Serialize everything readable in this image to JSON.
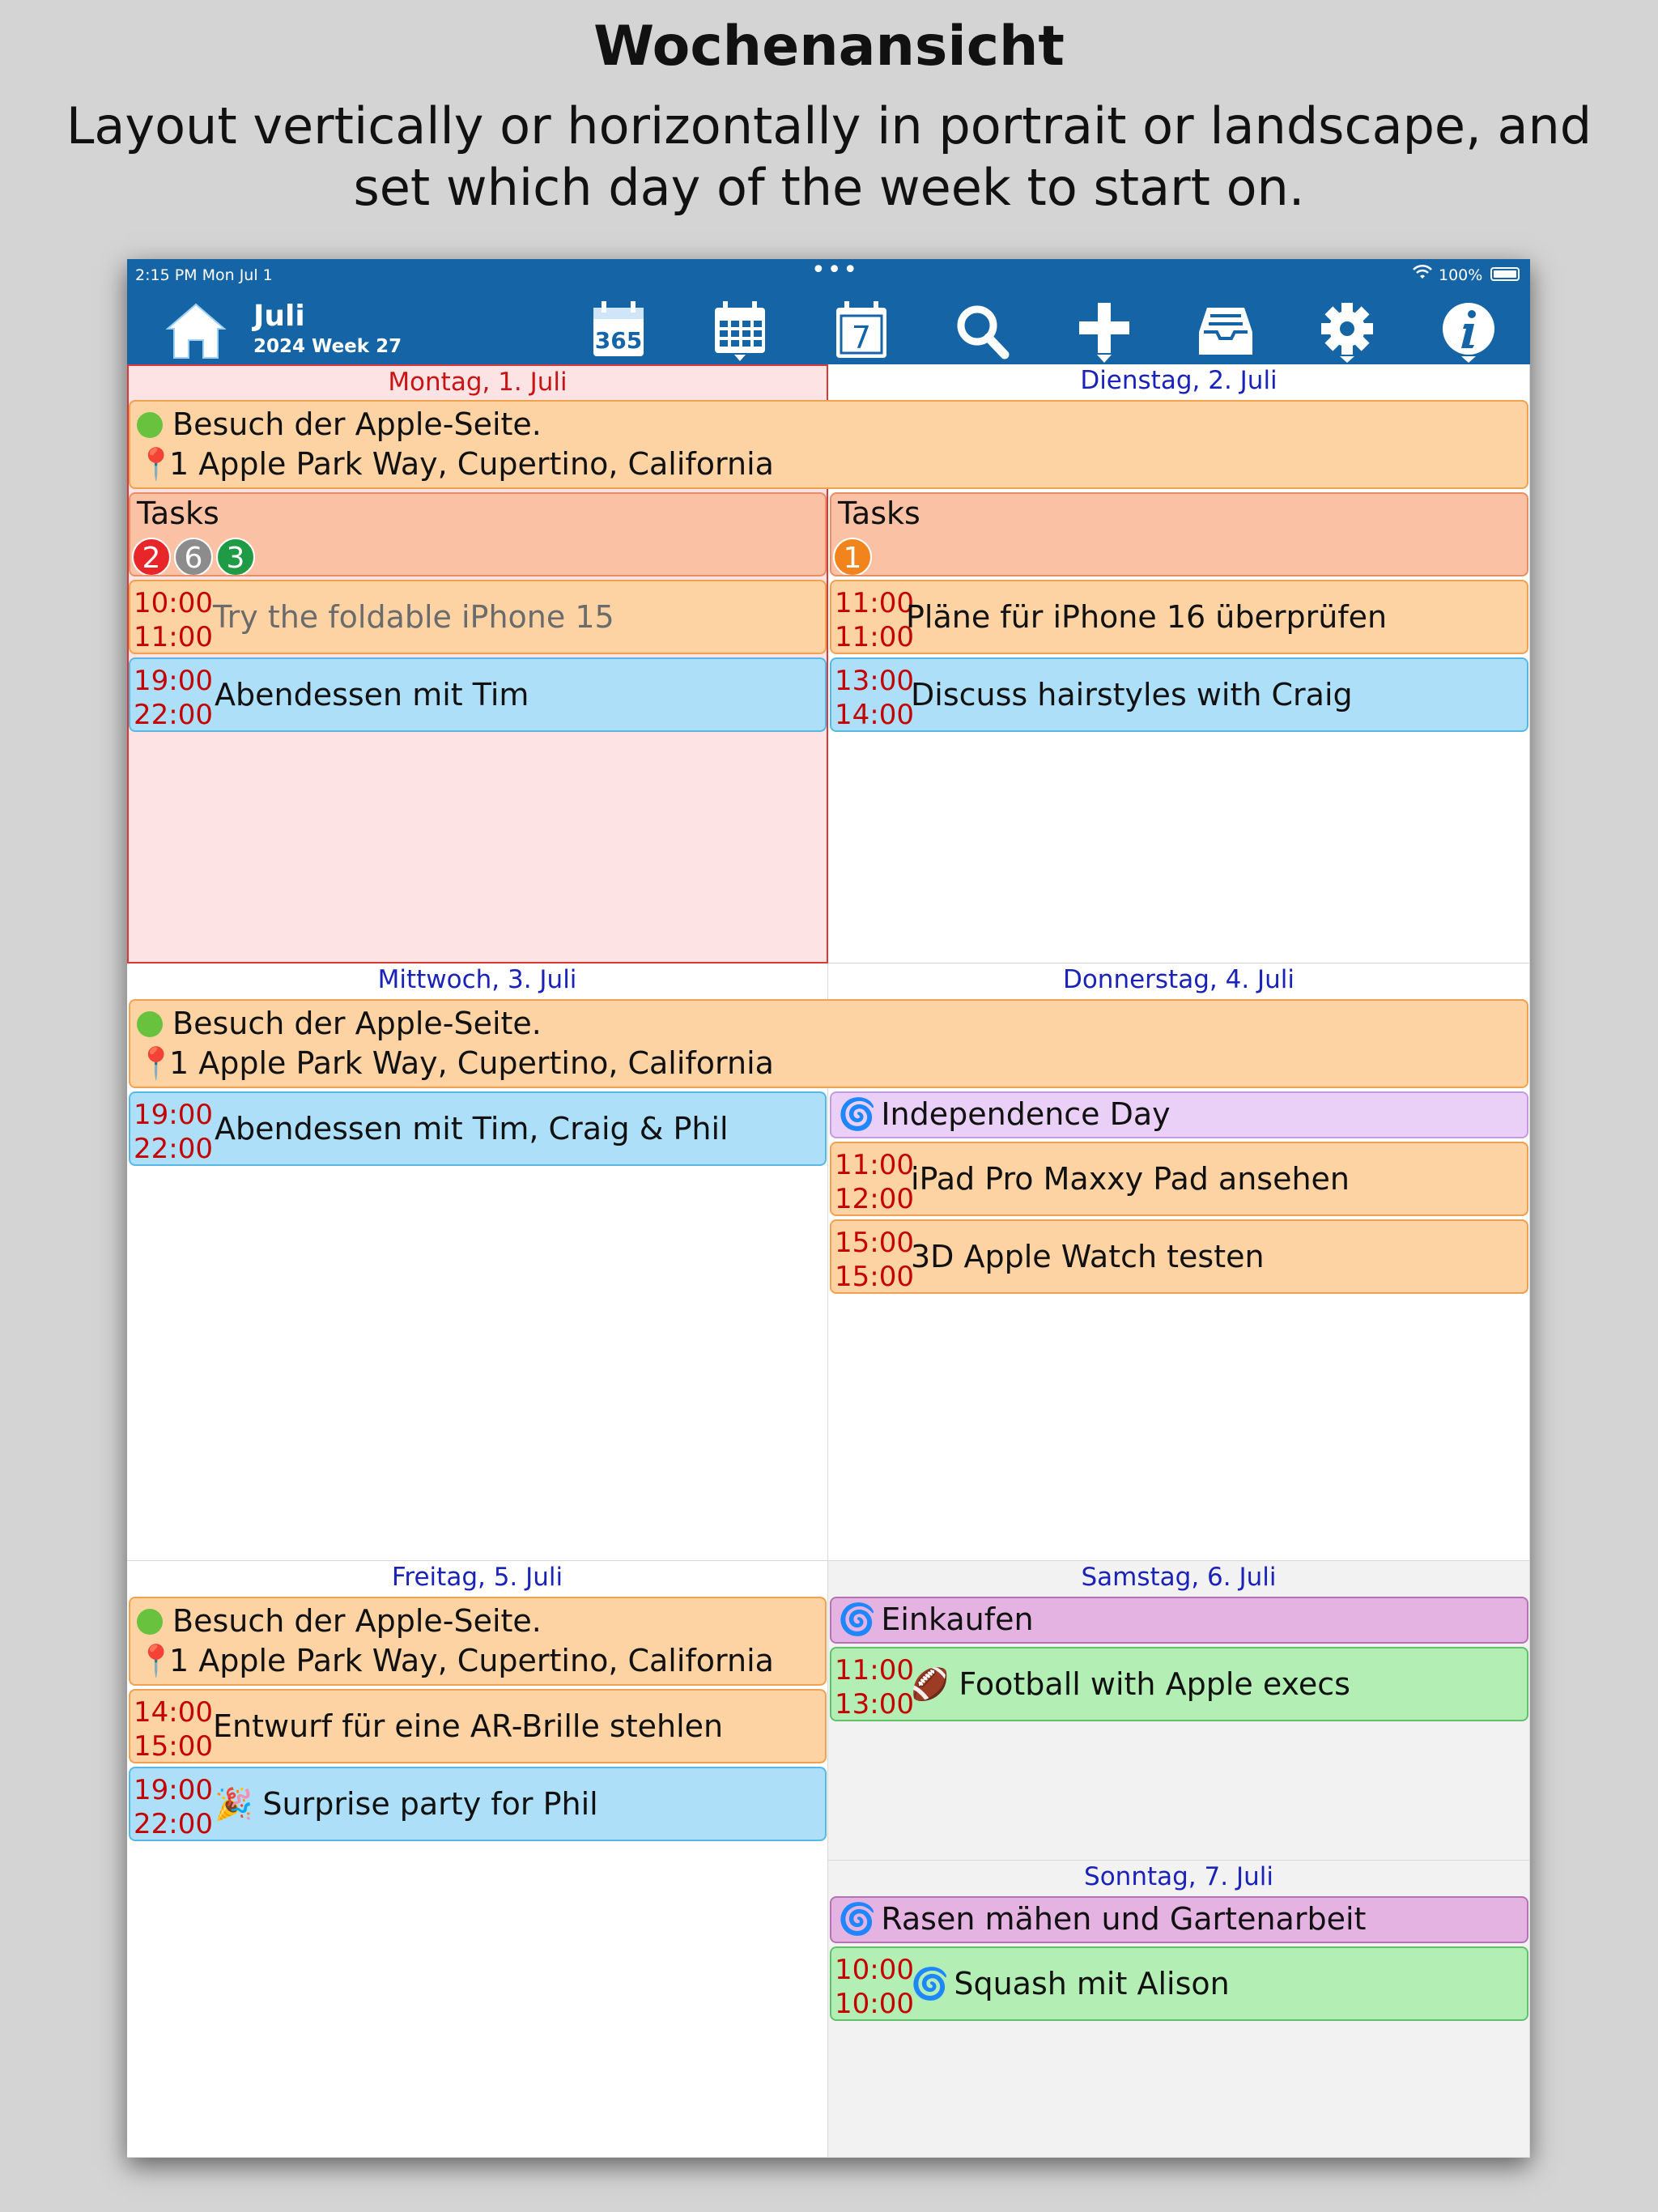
{
  "marketing": {
    "title": "Wochenansicht",
    "subtitle": "Layout vertically or horizontally in portrait or landscape, and set which day of the week to start on."
  },
  "statusbar": {
    "time": "2:15 PM   Mon Jul 1",
    "dots": "•••",
    "battery_text": "100%"
  },
  "toolbar": {
    "month": "Juli",
    "week": "2024 Week 27",
    "year_icon_text": "365",
    "day_icon_text": "7",
    "icons": [
      "home-icon",
      "year-view-icon",
      "month-view-icon",
      "day-view-icon",
      "search-icon",
      "add-icon",
      "inbox-icon",
      "settings-icon",
      "info-icon"
    ]
  },
  "colors": {
    "toolbar_bg": "#1565a6",
    "today_bg": "#fde3e4",
    "today_border": "#d83a3a",
    "time_red": "#c40000",
    "day_header_blue": "#1a23b8"
  },
  "days": {
    "mon": {
      "header": "Montag, 1. Juli",
      "tasks_label": "Tasks",
      "badges": [
        "2",
        "6",
        "3"
      ],
      "events": [
        {
          "start": "10:00",
          "end": "11:00",
          "title": "Try the foldable iPhone 15"
        },
        {
          "start": "19:00",
          "end": "22:00",
          "title": "Abendessen mit Tim"
        }
      ]
    },
    "tue": {
      "header": "Dienstag, 2. Juli",
      "tasks_label": "Tasks",
      "badges": [
        "1"
      ],
      "events": [
        {
          "start": "11:00",
          "end": "11:00",
          "title": "Pläne für iPhone 16 überprüfen"
        },
        {
          "start": "13:00",
          "end": "14:00",
          "title": "Discuss hairstyles with Craig"
        }
      ]
    },
    "wed": {
      "header": "Mittwoch, 3. Juli",
      "events": [
        {
          "start": "19:00",
          "end": "22:00",
          "title": "Abendessen mit Tim, Craig & Phil"
        }
      ]
    },
    "thu": {
      "header": "Donnerstag, 4. Juli",
      "allday": "Independence Day",
      "events": [
        {
          "start": "11:00",
          "end": "12:00",
          "title": "iPad Pro Maxxy Pad ansehen"
        },
        {
          "start": "15:00",
          "end": "15:00",
          "title": "3D Apple Watch testen"
        }
      ]
    },
    "fri": {
      "header": "Freitag, 5. Juli",
      "events": [
        {
          "start": "14:00",
          "end": "15:00",
          "title": "Entwurf für eine AR-Brille stehlen"
        },
        {
          "start": "19:00",
          "end": "22:00",
          "title": "🎉 Surprise party for Phil"
        }
      ]
    },
    "sat": {
      "header": "Samstag, 6. Juli",
      "allday": "Einkaufen",
      "events": [
        {
          "start": "11:00",
          "end": "13:00",
          "title": "🏈 Football with Apple execs"
        }
      ]
    },
    "sun": {
      "header": "Sonntag, 7. Juli",
      "allday": "Rasen mähen und Gartenarbeit",
      "events": [
        {
          "start": "10:00",
          "end": "10:00",
          "title": "Squash mit Alison"
        }
      ]
    }
  },
  "multiday": {
    "title": "Besuch der Apple-Seite.",
    "location": "1 Apple Park Way, Cupertino, California"
  }
}
